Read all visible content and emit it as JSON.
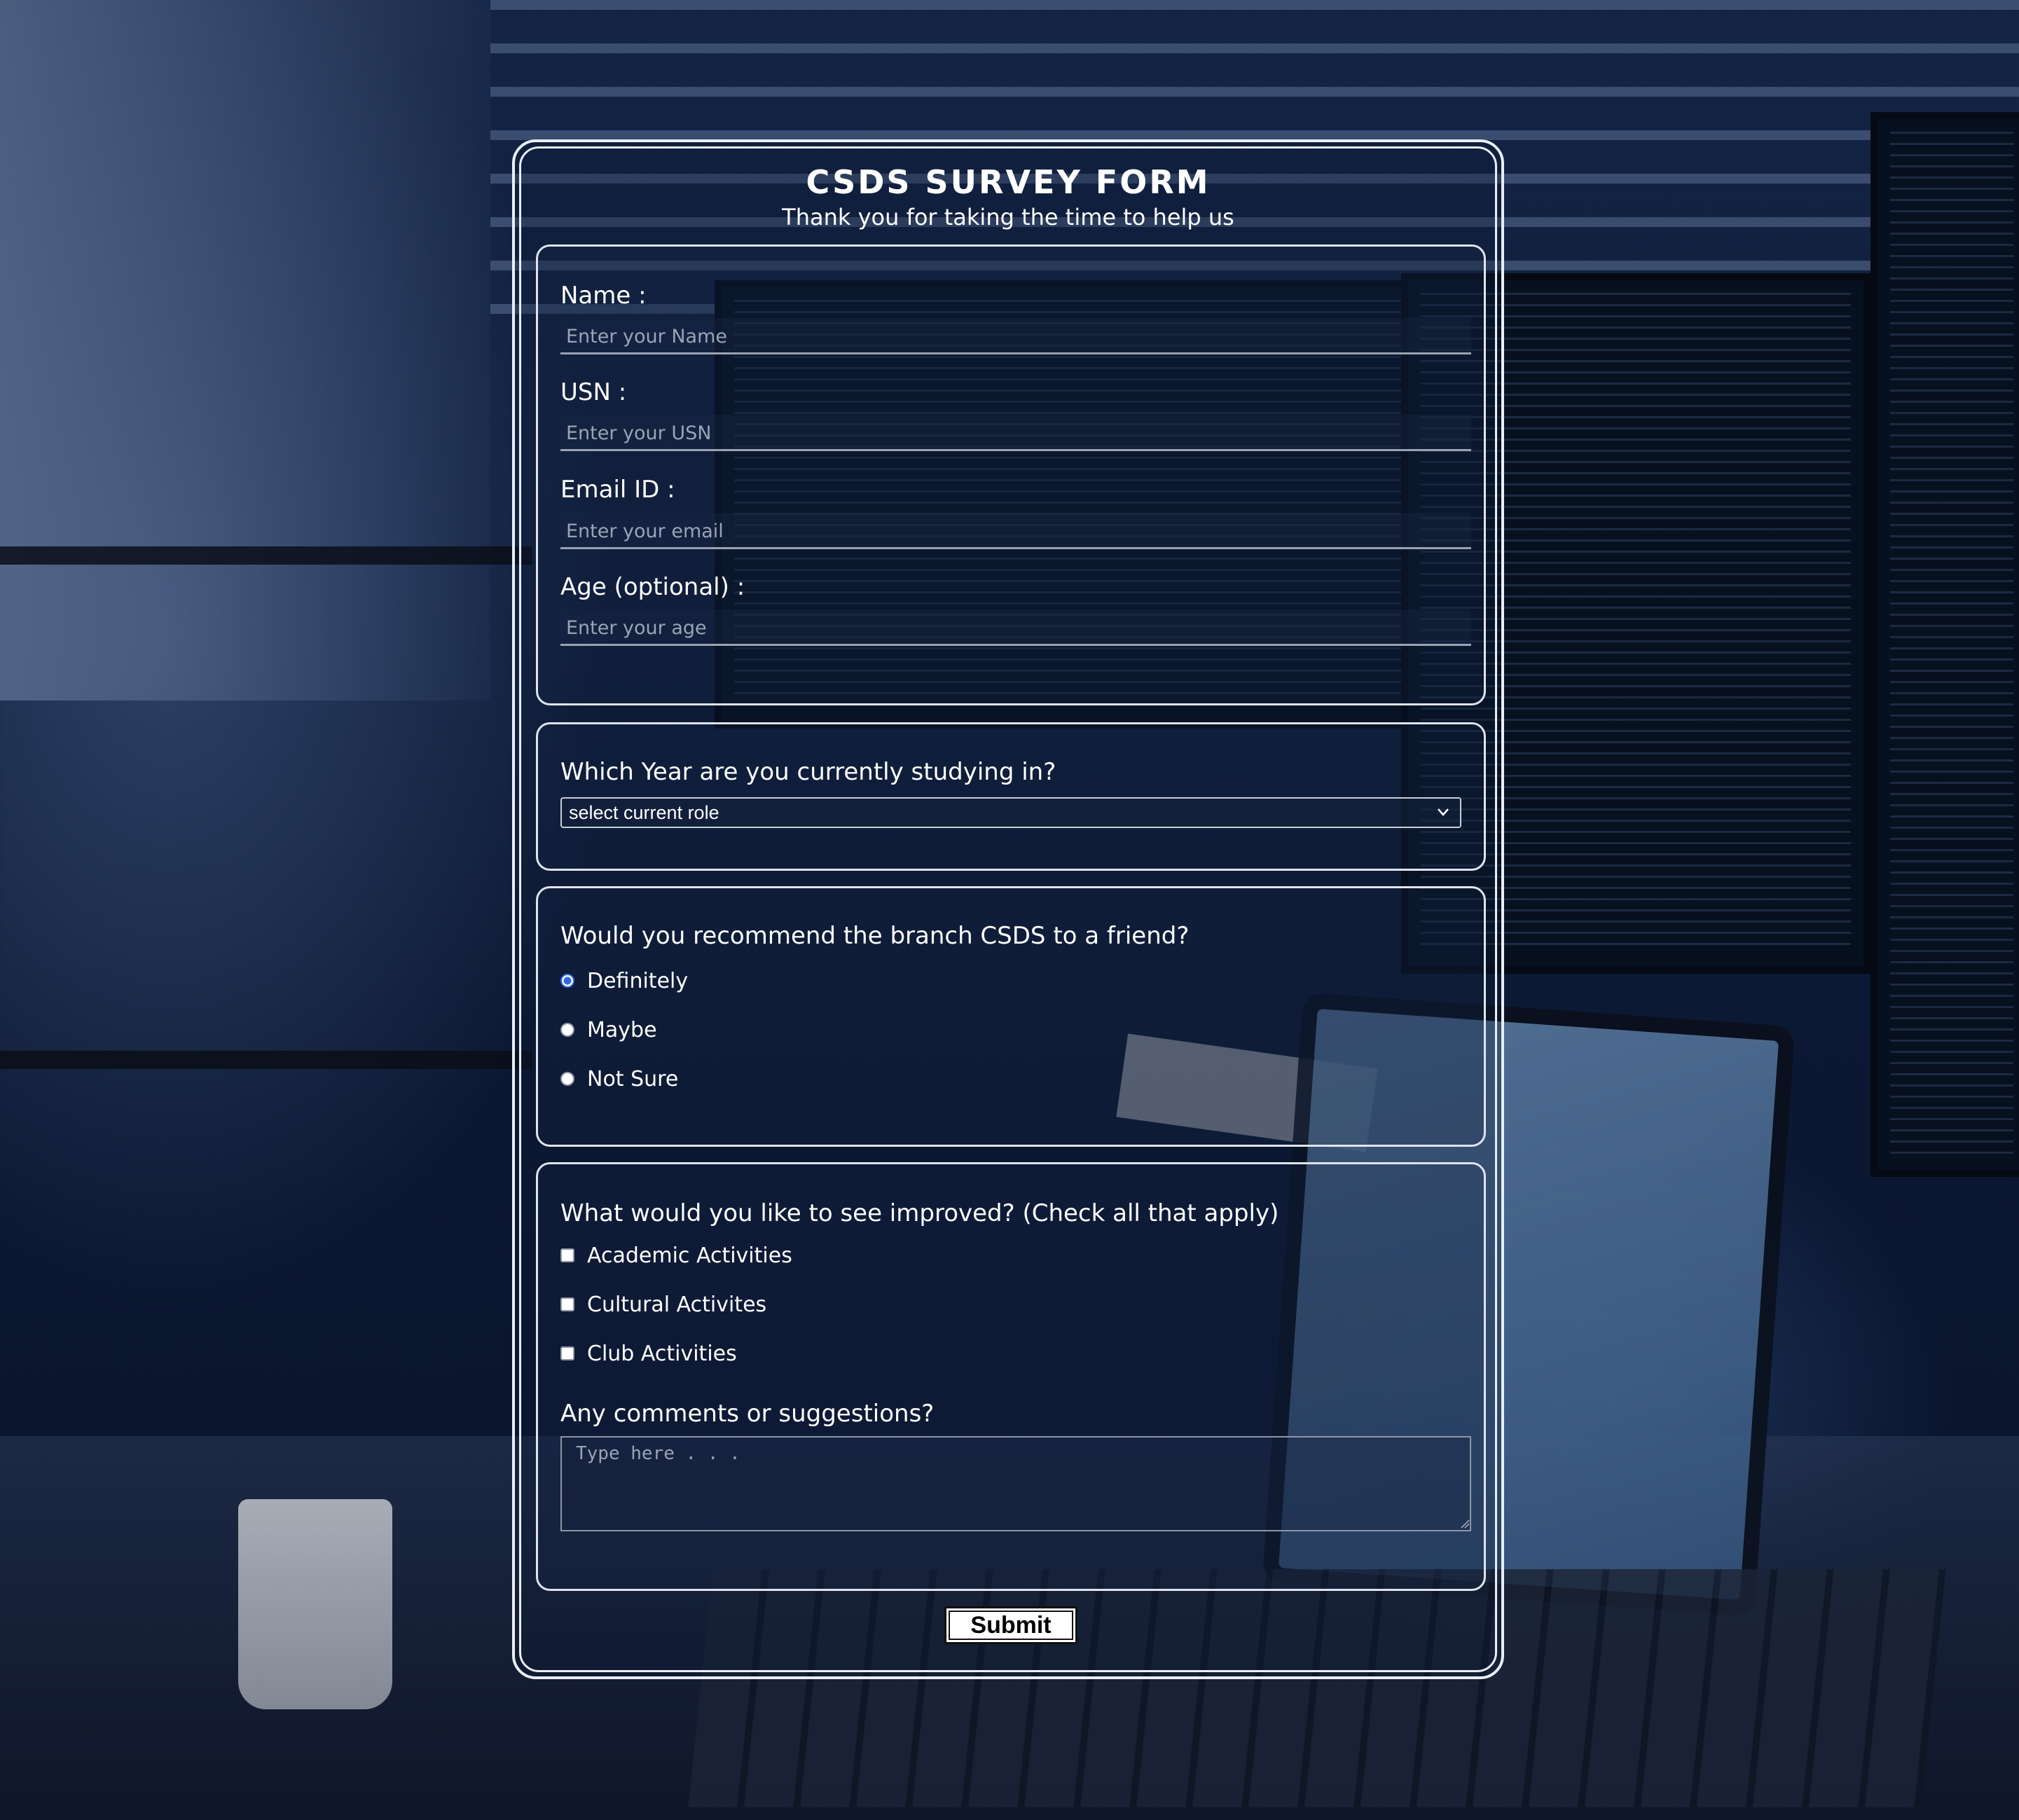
{
  "header": {
    "title": "CSDS SURVEY FORM",
    "subtitle": "Thank you for taking the time to help us"
  },
  "personal": {
    "name_label": "Name :",
    "name_placeholder": "Enter your Name",
    "name_value": "",
    "usn_label": "USN :",
    "usn_placeholder": "Enter your USN",
    "usn_value": "",
    "email_label": "Email ID :",
    "email_placeholder": "Enter your email",
    "email_value": "",
    "age_label": "Age (optional) :",
    "age_placeholder": "Enter your age",
    "age_value": ""
  },
  "year": {
    "question": "Which Year are you currently studying in?",
    "selected": "select current role"
  },
  "recommend": {
    "question": "Would you recommend the branch CSDS to a friend?",
    "options": [
      {
        "label": "Definitely",
        "checked": true
      },
      {
        "label": "Maybe",
        "checked": false
      },
      {
        "label": "Not Sure",
        "checked": false
      }
    ]
  },
  "improve": {
    "question": "What would you like to see improved? (Check all that apply)",
    "options": [
      {
        "label": "Academic Activities",
        "checked": false
      },
      {
        "label": "Cultural Activites",
        "checked": false
      },
      {
        "label": "Club Activities",
        "checked": false
      }
    ],
    "comments_label": "Any comments or suggestions?",
    "comments_placeholder": "Type here . . ."
  },
  "submit_label": "Submit",
  "colors": {
    "radio_accent": "#2f6be0",
    "text": "#ffffff",
    "border": "#e9eef6"
  },
  "icons": {
    "select_arrow": "chevron-down-icon",
    "textarea_resize": "resize-grip-icon"
  }
}
